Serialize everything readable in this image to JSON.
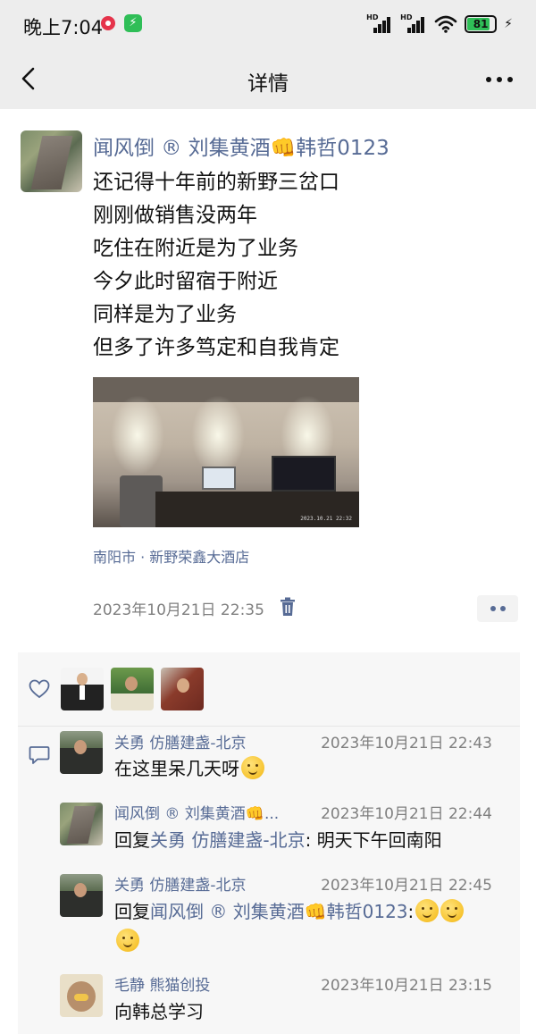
{
  "status_bar": {
    "time": "晚上7:04",
    "battery": "81",
    "signal_label": "HD"
  },
  "nav": {
    "title": "详情"
  },
  "post": {
    "author": "闻风倒 ® 刘集黄酒👊韩哲0123",
    "lines": [
      "还记得十年前的新野三岔口",
      "刚刚做销售没两年",
      "吃住在附近是为了业务",
      "今夕此时留宿于附近",
      "同样是为了业务",
      "但多了许多笃定和自我肯定"
    ],
    "photo_timestamp": "2023.10.21 22:32",
    "location": "南阳市 · 新野荣鑫大酒店",
    "time": "2023年10月21日 22:35"
  },
  "comments": [
    {
      "name": "关勇  仿膳建盏-北京",
      "time": "2023年10月21日 22:43",
      "text": "在这里呆几天呀",
      "emoji": "smile"
    },
    {
      "name": "闻风倒 ® 刘集黄酒👊...",
      "time": "2023年10月21日 22:44",
      "reply_prefix": "回复",
      "reply_to": "关勇  仿膳建盏-北京",
      "text": ": 明天下午回南阳"
    },
    {
      "name": "关勇  仿膳建盏-北京",
      "time": "2023年10月21日 22:45",
      "reply_prefix": "回复",
      "reply_to": "闻风倒 ® 刘集黄酒👊韩哲0123",
      "text": ":",
      "emoji": "smile"
    },
    {
      "name": "毛静  熊猫创投",
      "time": "2023年10月21日 23:15",
      "text": "向韩总学习"
    }
  ],
  "icons": {
    "back": "chevron-left-icon",
    "more": "more-dots-icon",
    "trash": "trash-icon",
    "like": "heart-icon",
    "comment": "comment-bubble-icon"
  },
  "colors": {
    "link": "#576b95",
    "nav_bg": "#ededed",
    "panel_bg": "#f7f7f7",
    "time_gray": "#7f7f7f"
  }
}
